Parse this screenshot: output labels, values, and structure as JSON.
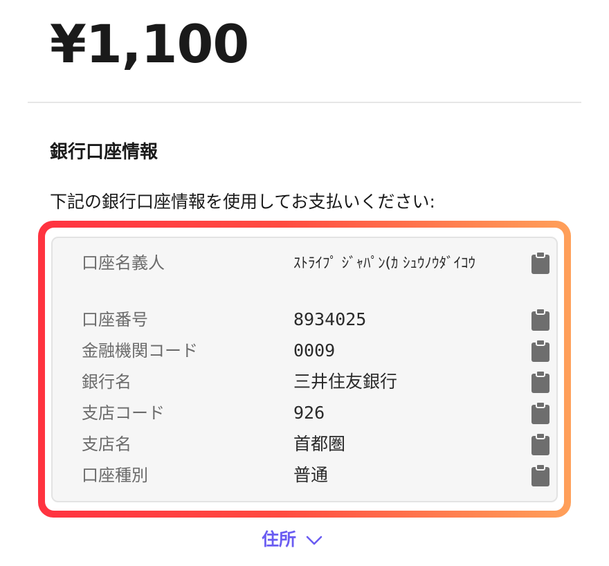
{
  "payment": {
    "amount": "¥1,100"
  },
  "bank_section": {
    "title": "銀行口座情報",
    "instruction": "下記の銀行口座情報を使用してお支払いください:",
    "rows": [
      {
        "label": "口座名義人",
        "value": "ｽﾄﾗｲﾌﾟ ｼﾞｬﾊﾟﾝ(ｶ ｼｭｳﾉｳﾀﾞｲｺｳ",
        "copy_icon": "clipboard-icon"
      },
      {
        "label": "口座番号",
        "value": "8934025",
        "copy_icon": "clipboard-icon"
      },
      {
        "label": "金融機関コード",
        "value": "0009",
        "copy_icon": "clipboard-icon"
      },
      {
        "label": "銀行名",
        "value": "三井住友銀行",
        "copy_icon": "clipboard-icon"
      },
      {
        "label": "支店コード",
        "value": "926",
        "copy_icon": "clipboard-icon"
      },
      {
        "label": "支店名",
        "value": "首都圏",
        "copy_icon": "clipboard-icon"
      },
      {
        "label": "口座種別",
        "value": "普通",
        "copy_icon": "clipboard-icon"
      }
    ]
  },
  "address": {
    "label": "住所",
    "icon": "chevron-down-icon"
  },
  "colors": {
    "accent": "#6a5cf2",
    "highlight_start": "#ff3340",
    "highlight_end": "#ffa05a",
    "card_bg": "#f6f6f6",
    "label_text": "#6b6b6b"
  }
}
